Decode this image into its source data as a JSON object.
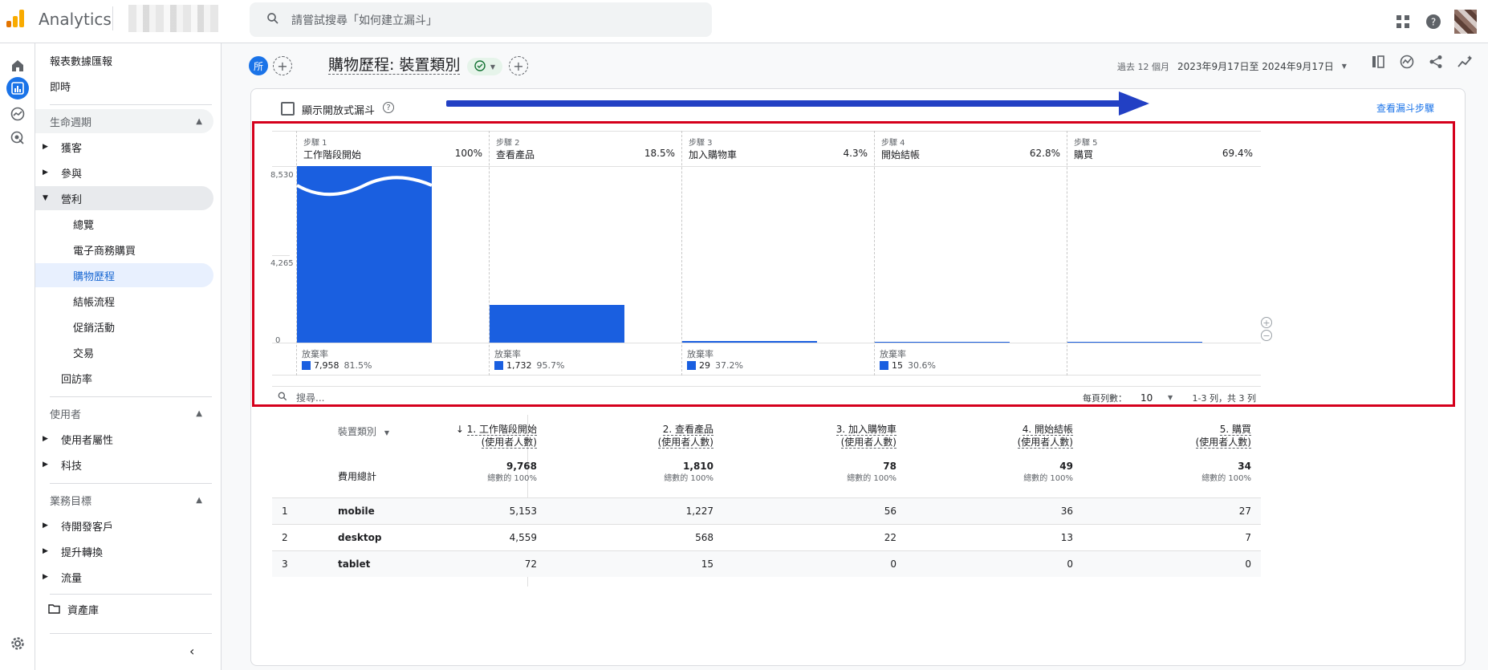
{
  "topbar": {
    "app_name": "Analytics",
    "search_placeholder": "請嘗試搜尋「如何建立漏斗」"
  },
  "sidenav": {
    "reports_snapshot": "報表數據匯報",
    "realtime": "即時",
    "lifecycle": "生命週期",
    "acquisition": "獲客",
    "engagement": "參與",
    "monetization": "營利",
    "overview": "總覽",
    "ecommerce": "電子商務購買",
    "purchase_journey": "購物歷程",
    "checkout_journey": "結帳流程",
    "promotions": "促銷活動",
    "transactions": "交易",
    "retention": "回訪率",
    "user": "使用者",
    "user_attributes": "使用者屬性",
    "tech": "科技",
    "business_objectives": "業務目標",
    "leads": "待開發客戶",
    "conversions": "提升轉換",
    "traffic": "流量",
    "library": "資產庫"
  },
  "header": {
    "segment_badge": "所",
    "title": "購物歷程: 裝置類別",
    "date_prefix": "過去 12 個月",
    "date_range": "2023年9月17日至 2024年9月17日"
  },
  "card": {
    "open_funnel_label": "顯示開放式漏斗",
    "view_steps_link": "查看漏斗步驟"
  },
  "chart_data": {
    "type": "bar",
    "yticks": [
      "8,530",
      "4,265",
      "0"
    ],
    "steps": [
      {
        "step": "步驟 1",
        "name": "工作階段開始",
        "pct": "100%",
        "value": 9768,
        "abandon_label": "放棄率",
        "abandon_count": "7,958",
        "abandon_rate": "81.5%"
      },
      {
        "step": "步驟 2",
        "name": "查看產品",
        "pct": "18.5%",
        "value": 1810,
        "abandon_label": "放棄率",
        "abandon_count": "1,732",
        "abandon_rate": "95.7%"
      },
      {
        "step": "步驟 3",
        "name": "加入購物車",
        "pct": "4.3%",
        "value": 78,
        "abandon_label": "放棄率",
        "abandon_count": "29",
        "abandon_rate": "37.2%"
      },
      {
        "step": "步驟 4",
        "name": "開始結帳",
        "pct": "62.8%",
        "value": 49,
        "abandon_label": "放棄率",
        "abandon_count": "15",
        "abandon_rate": "30.6%"
      },
      {
        "step": "步驟 5",
        "name": "購買",
        "pct": "69.4%",
        "value": 34,
        "abandon_label": "",
        "abandon_count": "",
        "abandon_rate": ""
      }
    ],
    "ymax": 8530
  },
  "table": {
    "search_placeholder": "搜尋...",
    "rows_per_page_label": "每頁列數：",
    "rows_per_page": "10",
    "pagination": "1-3 列，共 3 列",
    "dim_header": "裝置類別",
    "columns": [
      {
        "title": "1. 工作階段開始",
        "sub": "(使用者人數)"
      },
      {
        "title": "2. 查看產品",
        "sub": "(使用者人數)"
      },
      {
        "title": "3. 加入購物車",
        "sub": "(使用者人數)"
      },
      {
        "title": "4. 開始結帳",
        "sub": "(使用者人數)"
      },
      {
        "title": "5. 購買",
        "sub": "(使用者人數)"
      }
    ],
    "totals_label": "費用總計",
    "totals": [
      "9,768",
      "1,810",
      "78",
      "49",
      "34"
    ],
    "totals_sub": "總數的 100%",
    "rows": [
      {
        "idx": "1",
        "name": "mobile",
        "vals": [
          "5,153",
          "1,227",
          "56",
          "36",
          "27"
        ]
      },
      {
        "idx": "2",
        "name": "desktop",
        "vals": [
          "4,559",
          "568",
          "22",
          "13",
          "7"
        ]
      },
      {
        "idx": "3",
        "name": "tablet",
        "vals": [
          "72",
          "15",
          "0",
          "0",
          "0"
        ]
      }
    ]
  }
}
